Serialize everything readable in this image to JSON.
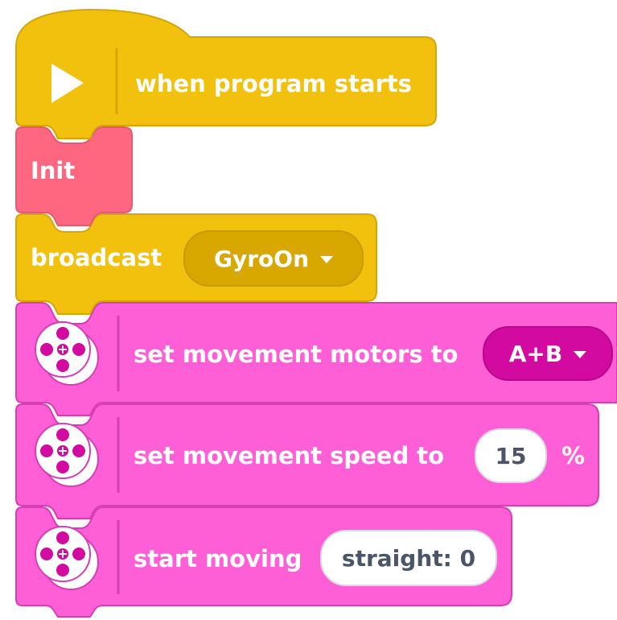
{
  "colors": {
    "event_yellow": "#f2c10e",
    "event_yellow_dark": "#d9a800",
    "event_yellow_border": "#d4a60a",
    "myblock_red": "#ff6680",
    "myblock_red_border": "#e05a72",
    "movement_pink": "#ff5fd6",
    "movement_pink_border": "#d43fb4",
    "dropdown_magenta": "#d30aa0",
    "white": "#ffffff"
  },
  "blocks": {
    "when_program_starts": {
      "icon": "play-icon",
      "label": "when program starts"
    },
    "init": {
      "label": "Init"
    },
    "broadcast": {
      "label": "broadcast",
      "message": "GyroOn",
      "caret_icon": "caret-down-icon"
    },
    "set_motors": {
      "icon": "movement-motor-icon",
      "label": "set movement motors to",
      "value": "A+B",
      "caret_icon": "caret-down-icon"
    },
    "set_speed": {
      "icon": "movement-motor-icon",
      "label": "set movement speed to",
      "value": "15",
      "unit": "%"
    },
    "start_moving": {
      "icon": "movement-motor-icon",
      "label": "start moving",
      "value": "straight: 0"
    }
  }
}
